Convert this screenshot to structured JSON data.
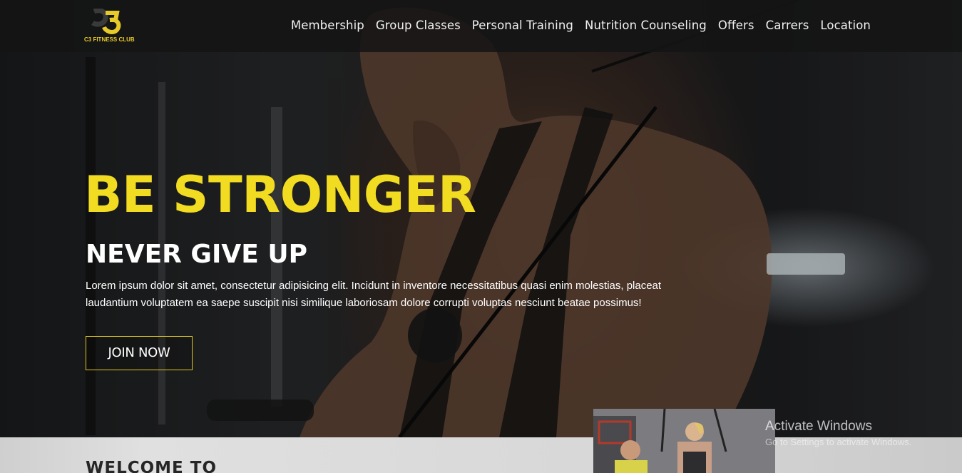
{
  "brand": {
    "logo_text": "C3 FITNESS CLUB",
    "accent_color": "#f1dc21"
  },
  "nav": {
    "items": [
      {
        "label": "Membership"
      },
      {
        "label": "Group Classes"
      },
      {
        "label": "Personal Training"
      },
      {
        "label": "Nutrition Counseling"
      },
      {
        "label": "Offers"
      },
      {
        "label": "Carrers"
      },
      {
        "label": "Location"
      }
    ]
  },
  "hero": {
    "headline": "BE STRONGER",
    "subheadline": "NEVER GIVE UP",
    "description": "Lorem ipsum dolor sit amet, consectetur adipisicing elit. Incidunt in inventore necessitatibus quasi enim molestias, placeat laudantium voluptatem ea saepe suscipit nisi similique laboriosam dolore corrupti voluptas nesciunt beatae possimus!",
    "cta_label": "JOIN NOW",
    "cta_border_color": "#e1c81f"
  },
  "welcome": {
    "title": "WELCOME TO"
  },
  "watermark": {
    "title": "Activate Windows",
    "subtitle": "Go to Settings to activate Windows."
  }
}
